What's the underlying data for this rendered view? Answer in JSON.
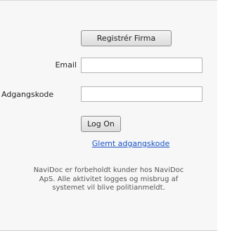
{
  "form": {
    "register_label": "Registrér Firma",
    "email_label": "Email",
    "email_value": "",
    "password_label": "Adgangskode",
    "password_value": "",
    "logon_label": "Log On",
    "forgot_label": "Glemt adgangskode"
  },
  "notice": {
    "line1": "NaviDoc er forbeholdt kunder hos NaviDoc",
    "line2": "ApS. Alle aktivitet logges og misbrug af",
    "line3": "systemet vil blive politianmeldt."
  }
}
